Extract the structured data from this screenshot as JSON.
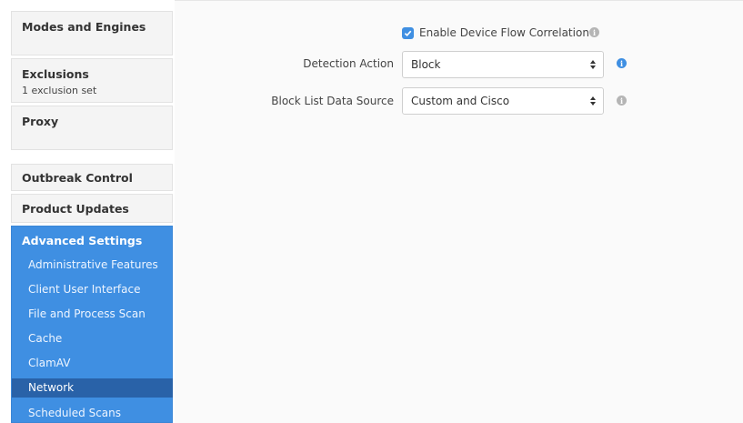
{
  "sidebar": {
    "sections": [
      {
        "title": "Modes and Engines",
        "subtitle": ""
      },
      {
        "title": "Exclusions",
        "subtitle": "1 exclusion set"
      },
      {
        "title": "Proxy",
        "subtitle": ""
      },
      {
        "title": "Outbreak Control",
        "subtitle": ""
      },
      {
        "title": "Product Updates",
        "subtitle": ""
      }
    ],
    "advanced": {
      "title": "Advanced Settings",
      "items": [
        {
          "label": "Administrative Features"
        },
        {
          "label": "Client User Interface"
        },
        {
          "label": "File and Process Scan"
        },
        {
          "label": "Cache"
        },
        {
          "label": "ClamAV"
        },
        {
          "label": "Network",
          "active": true
        },
        {
          "label": "Scheduled Scans"
        }
      ]
    }
  },
  "form": {
    "enable_dfc": {
      "label": "Enable Device Flow Correlation",
      "checked": true
    },
    "detection_action": {
      "label": "Detection Action",
      "value": "Block"
    },
    "block_list_source": {
      "label": "Block List Data Source",
      "value": "Custom and Cisco"
    }
  },
  "colors": {
    "accent": "#3f8fe2",
    "active_item": "#2962a8",
    "info_blue": "#3f8fe2",
    "info_grey": "#b5b5b5"
  },
  "icons": {
    "checkbox": "checkmark-icon",
    "info": "info-icon",
    "select": "select-arrows-icon"
  }
}
